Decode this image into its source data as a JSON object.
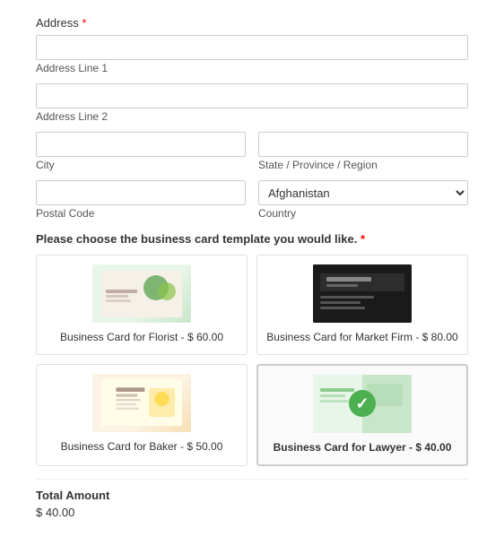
{
  "form": {
    "address_header": "Address",
    "required_marker": "*",
    "address_line1_placeholder": "",
    "address_line1_label": "Address Line 1",
    "address_line2_placeholder": "",
    "address_line2_label": "Address Line 2",
    "city_label": "City",
    "city_placeholder": "",
    "state_label": "State / Province / Region",
    "state_placeholder": "",
    "postal_label": "Postal Code",
    "postal_placeholder": "",
    "country_label": "Country",
    "country_value": "Afghanistan",
    "choose_label": "Please choose the business card template you would like.",
    "choose_required": "*"
  },
  "cards": [
    {
      "id": "florist",
      "label": "Business Card for Florist - $ 60.00",
      "selected": false,
      "thumb_type": "florist"
    },
    {
      "id": "market",
      "label": "Business Card for Market Firm - $ 80.00",
      "selected": false,
      "thumb_type": "market"
    },
    {
      "id": "baker",
      "label": "Business Card for Baker - $ 50.00",
      "selected": false,
      "thumb_type": "baker"
    },
    {
      "id": "lawyer",
      "label": "Business Card for Lawyer - $ 40.00",
      "selected": true,
      "thumb_type": "lawyer"
    }
  ],
  "total": {
    "label": "Total Amount",
    "amount": "$ 40.00"
  }
}
